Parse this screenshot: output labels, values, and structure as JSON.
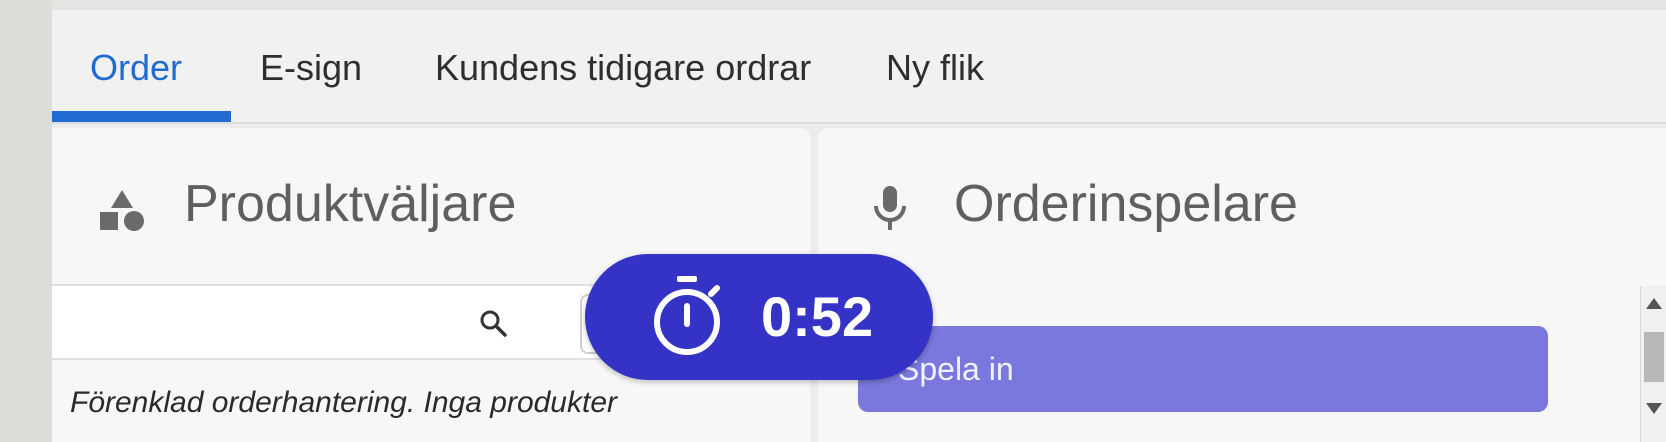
{
  "tabs": [
    {
      "label": "Order",
      "active": true
    },
    {
      "label": "E-sign",
      "active": false
    },
    {
      "label": "Kundens tidigare ordrar",
      "active": false
    },
    {
      "label": "Ny flik",
      "active": false
    }
  ],
  "product_panel": {
    "title": "Produktväljare",
    "icon": "shapes-icon",
    "search": {
      "value": "",
      "placeholder": ""
    },
    "info_text": "Förenklad orderhantering. Inga produkter"
  },
  "recorder_panel": {
    "title": "Orderinspelare",
    "icon": "microphone-icon",
    "record_button_label": "Spela in"
  },
  "timer": {
    "value": "0:52",
    "icon": "stopwatch-icon"
  },
  "colors": {
    "accent": "#1f6bd1",
    "timer_bg": "#3433c6",
    "record_button": "#7a78dc"
  }
}
